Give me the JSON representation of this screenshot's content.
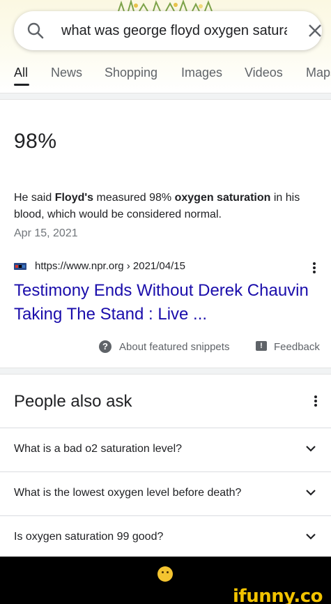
{
  "search": {
    "query": "what was george floyd oxygen saturation"
  },
  "tabs": [
    {
      "label": "All",
      "active": true
    },
    {
      "label": "News"
    },
    {
      "label": "Shopping"
    },
    {
      "label": "Images"
    },
    {
      "label": "Videos"
    },
    {
      "label": "Maps"
    }
  ],
  "featured_snippet": {
    "answer": "98%",
    "text_parts": [
      "He said ",
      "Floyd's",
      " measured 98% ",
      "oxygen saturation",
      " in his blood, which would be considered normal."
    ],
    "date": "Apr 15, 2021",
    "source_url": "https://www.npr.org › 2021/04/15",
    "title": "Testimony Ends Without Derek Chauvin Taking The Stand : Live ...",
    "about_label": "About featured snippets",
    "feedback_label": "Feedback"
  },
  "people_also_ask": {
    "title": "People also ask",
    "questions": [
      "What is a bad o2 saturation level?",
      "What is the lowest oxygen level before death?",
      "Is oxygen saturation 99 good?"
    ]
  },
  "watermark": "ifunny.co",
  "colors": {
    "link": "#1a0dab",
    "secondary_text": "#5f6368",
    "watermark": "#f2c300"
  }
}
